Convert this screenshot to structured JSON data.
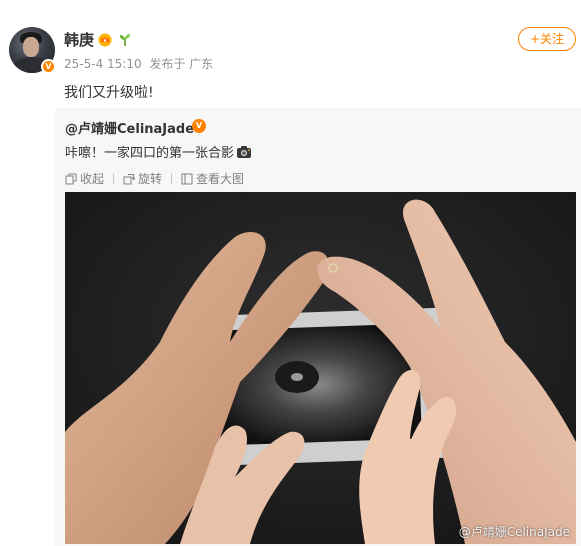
{
  "post": {
    "author": "韩庚",
    "date": "25-5-4 15:10",
    "via": "发布于 广东",
    "text": "我们又升级啦!",
    "follow_label": "+关注"
  },
  "repost": {
    "author": "@卢靖姗CelinaJade",
    "text": "咔嚓！一家四口的第一张合影",
    "actions": [
      {
        "label": "收起",
        "icon": "collapse-icon"
      },
      {
        "label": "旋转",
        "icon": "rotate-icon"
      },
      {
        "label": "查看大图",
        "icon": "zoom-icon"
      }
    ],
    "image_watermark": "@卢靖姗CelinaJade"
  },
  "colors": {
    "accent": "#ff8200",
    "repost_bg": "#f7f7f7",
    "meta_text": "#939393"
  }
}
